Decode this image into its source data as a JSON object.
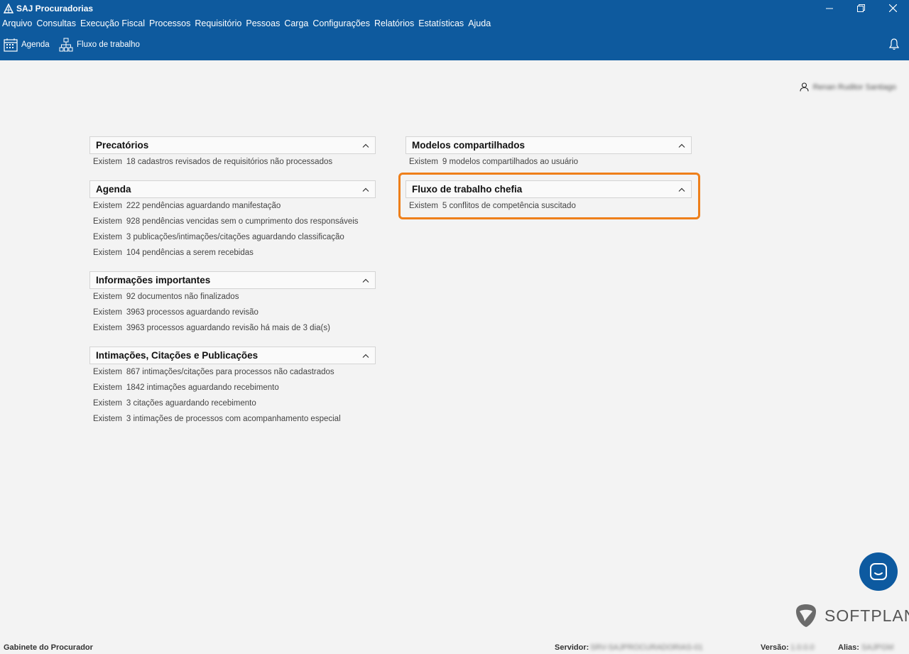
{
  "window": {
    "title": "SAJ Procuradorias"
  },
  "menu": [
    "Arquivo",
    "Consultas",
    "Execução Fiscal",
    "Processos",
    "Requisitório",
    "Pessoas",
    "Carga",
    "Configurações",
    "Relatórios",
    "Estatísticas",
    "Ajuda"
  ],
  "toolbar": {
    "agenda": "Agenda",
    "fluxo": "Fluxo de trabalho"
  },
  "user": {
    "name": "Renan Ruditor Santiago"
  },
  "panels": {
    "precatorios": {
      "title": "Precatórios",
      "lines": [
        {
          "kw": "Existem",
          "text": "18 cadastros revisados de requisitórios não processados"
        }
      ]
    },
    "agenda": {
      "title": "Agenda",
      "lines": [
        {
          "kw": "Existem",
          "text": "222 pendências aguardando manifestação"
        },
        {
          "kw": "Existem",
          "text": "928 pendências vencidas sem o cumprimento dos responsáveis"
        },
        {
          "kw": "Existem",
          "text": "3 publicações/intimações/citações aguardando classificação"
        },
        {
          "kw": "Existem",
          "text": "104 pendências a serem recebidas"
        }
      ]
    },
    "informacoes": {
      "title": "Informações importantes",
      "lines": [
        {
          "kw": "Existem",
          "text": "92 documentos não finalizados"
        },
        {
          "kw": "Existem",
          "text": "3963 processos aguardando revisão"
        },
        {
          "kw": "Existem",
          "text": "3963 processos aguardando revisão há mais de 3 dia(s)"
        }
      ]
    },
    "intimacoes": {
      "title": "Intimações, Citações e Publicações",
      "lines": [
        {
          "kw": "Existem",
          "text": "867 intimações/citações para processos não cadastrados"
        },
        {
          "kw": "Existem",
          "text": "1842 intimações aguardando recebimento"
        },
        {
          "kw": "Existem",
          "text": "3 citações aguardando recebimento"
        },
        {
          "kw": "Existem",
          "text": "3 intimações de processos com acompanhamento especial"
        }
      ]
    },
    "modelos": {
      "title": "Modelos compartilhados",
      "lines": [
        {
          "kw": "Existem",
          "text": "9 modelos compartilhados ao usuário"
        }
      ]
    },
    "fluxo": {
      "title": "Fluxo de trabalho chefia",
      "lines": [
        {
          "kw": "Existem",
          "text": "5 conflitos de competência suscitado"
        }
      ]
    }
  },
  "brand": {
    "name": "SOFTPLAN"
  },
  "status": {
    "left": "Gabinete do Procurador",
    "servidor_label": "Servidor:",
    "servidor_value": "SRV-SAJPROCURADORIAS-01",
    "versao_label": "Versão:",
    "versao_value": "1.0.0.0",
    "alias_label": "Alias:",
    "alias_value": "SAJPGM"
  },
  "colors": {
    "topbar": "#0e5a9e",
    "highlight": "#ee7f1a"
  }
}
